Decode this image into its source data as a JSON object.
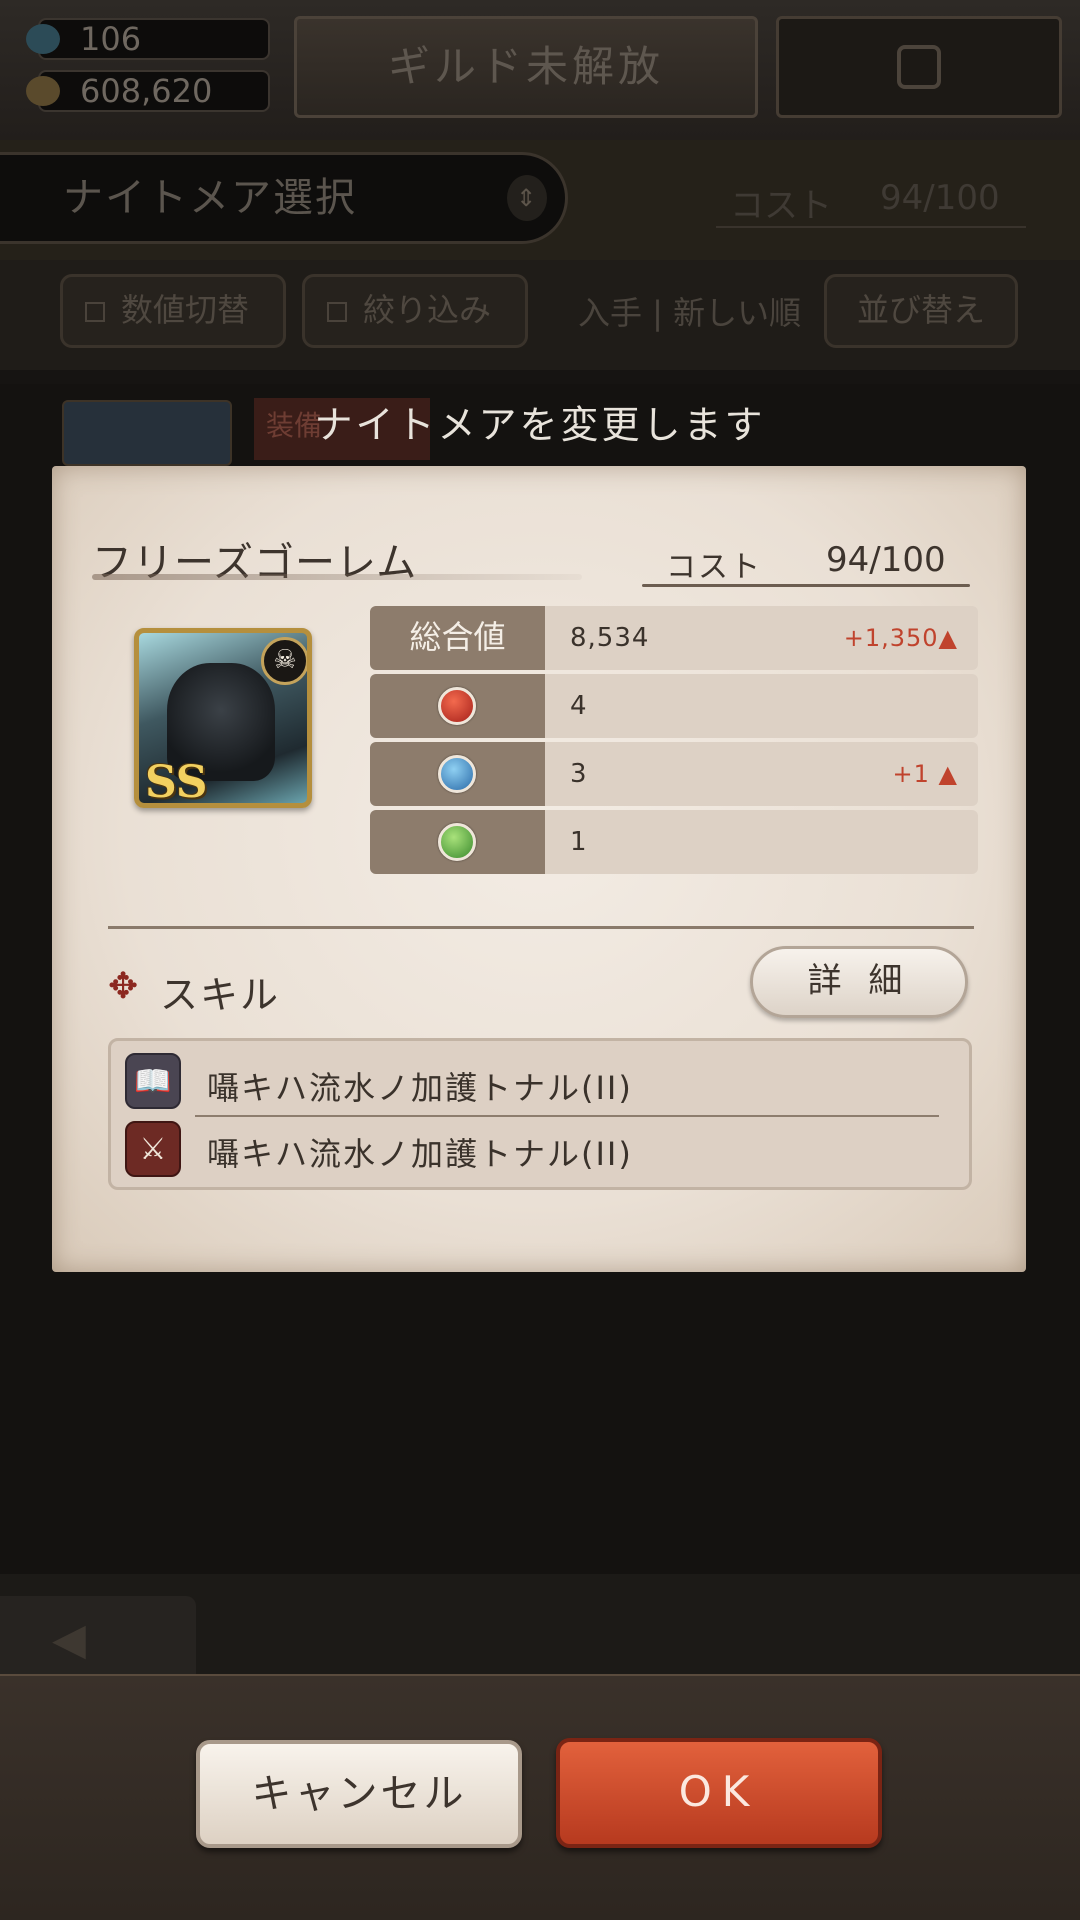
{
  "background": {
    "gems": "106",
    "coins": "608,620",
    "guild_button": "ギルド未解放",
    "select_title": "ナイトメア選択",
    "cost_label": "コスト",
    "cost_value": "94/100",
    "filter_toggle": "数値切替",
    "filter_narrow": "絞り込み",
    "sort_label": "入手 | 新しい順",
    "sort_button": "並び替え",
    "equip_tag": "装備"
  },
  "modal": {
    "title": "ナイトメアを変更します",
    "name": "フリーズゴーレム",
    "cost_label": "コスト",
    "cost_value": "94/100",
    "rank": "SS",
    "stats": [
      {
        "label": "総合値",
        "value": "8,534",
        "delta": "+1,350▲"
      },
      {
        "icon": "fire-element-icon",
        "value": "4",
        "delta": ""
      },
      {
        "icon": "water-element-icon",
        "value": "3",
        "delta": "+1 ▲"
      },
      {
        "icon": "wind-element-icon",
        "value": "1",
        "delta": ""
      }
    ],
    "skill_heading": "スキル",
    "detail_button": "詳 細",
    "skills": [
      {
        "icon": "book-icon",
        "text": "囁キハ流水ノ加護トナル(II)"
      },
      {
        "icon": "crossed-swords-icon",
        "text": "囁キハ流水ノ加護トナル(II)"
      }
    ]
  },
  "footer": {
    "cancel": "キャンセル",
    "ok": "OK"
  },
  "colors": {
    "accent_red": "#c0432d",
    "ok_button": "#d24f2d",
    "panel": "#eee5db"
  }
}
